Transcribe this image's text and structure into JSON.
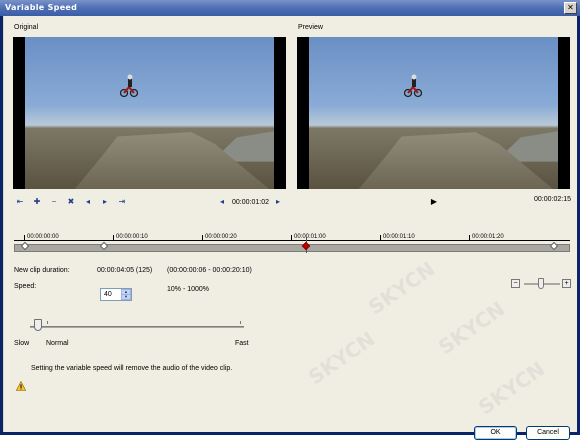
{
  "window": {
    "title": "Variable Speed"
  },
  "original": {
    "label": "Original",
    "timecode": "00:00:01:02"
  },
  "preview": {
    "label": "Preview",
    "timecode": "00:00:02:15"
  },
  "toolbar": {
    "icons": [
      "go-start-icon",
      "add-marker-icon",
      "remove-marker-icon",
      "clear-markers-icon",
      "previous-marker-icon",
      "next-marker-icon",
      "go-end-icon"
    ]
  },
  "timeline": {
    "labels": [
      "00:00:00:00",
      "00:00:00:10",
      "00:00:00:20",
      "00:00:01:00",
      "00:00:01:10",
      "00:00:01:20"
    ]
  },
  "details": {
    "duration_label": "New clip duration:",
    "duration_value": "00:00:04:05 (125)",
    "duration_range": "(00:00:00:06 - 00:00:20:10)",
    "speed_label": "Speed:",
    "speed_value": "40",
    "speed_range": "10% - 1000%",
    "slow_label": "Slow",
    "normal_label": "Normal",
    "fast_label": "Fast"
  },
  "warning": {
    "text": "Setting the variable speed will remove the audio of the video clip."
  },
  "buttons": {
    "ok": "OK",
    "cancel": "Cancel"
  },
  "colors": {
    "title_bar": "#4f6fb3",
    "client_bg": "#f0eee3",
    "active_marker": "#c00000"
  }
}
